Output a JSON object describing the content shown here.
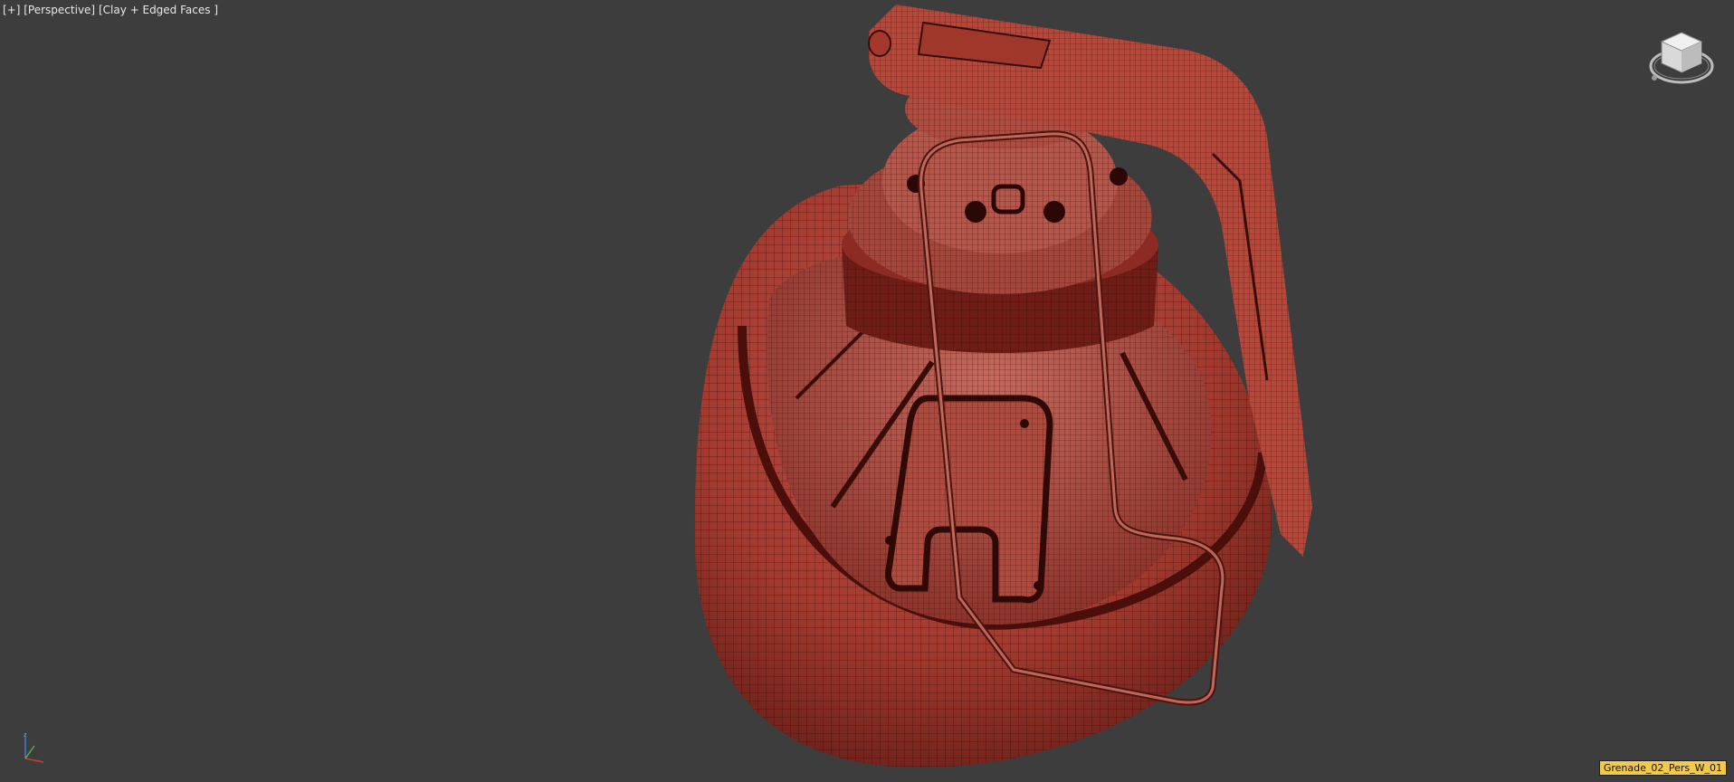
{
  "viewport": {
    "menu_label": "[+]",
    "view_label": "[Perspective]",
    "shading_label": "[Clay + Edged Faces ]",
    "camera_name": "Grenade_02_Pers_W_01",
    "background_color": "#3d3d3d",
    "model_color": "#a83a2e",
    "wire_color": "#3a0c08"
  },
  "icons": {
    "viewcube": "viewcube-icon",
    "axis": "axis-tripod-icon"
  }
}
